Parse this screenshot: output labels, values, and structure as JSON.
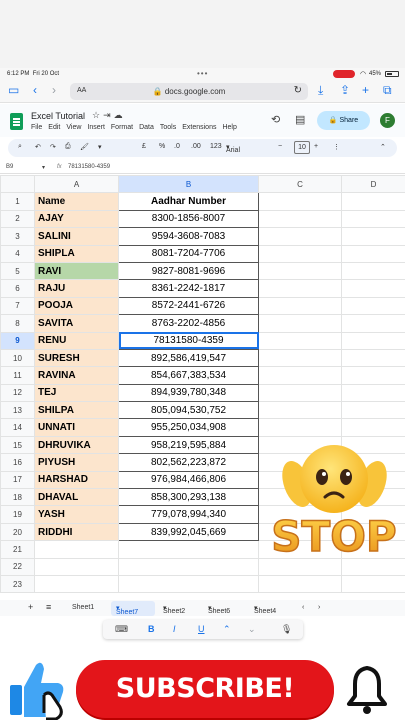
{
  "status": {
    "time": "6:12 PM",
    "date": "Fri 20 Oct",
    "battery": "45%"
  },
  "browser": {
    "aa": "AA",
    "url": "docs.google.com"
  },
  "sheets": {
    "title": "Excel Tutorial",
    "menu": [
      "File",
      "Edit",
      "View",
      "Insert",
      "Format",
      "Data",
      "Tools",
      "Extensions",
      "Help"
    ],
    "share_label": "Share",
    "avatar_letter": "F"
  },
  "toolbar": {
    "percent": "%",
    "dec_less": ".0",
    "dec_more": ".00",
    "num_fmt": "123",
    "font": "Arial",
    "font_size": "10"
  },
  "formula": {
    "cell_ref": "B9",
    "fx": "fx",
    "value": "78131580-4359"
  },
  "grid": {
    "columns": [
      "A",
      "B",
      "C",
      "D"
    ],
    "headers": {
      "name": "Name",
      "aadhar": "Aadhar Number"
    },
    "rows": [
      {
        "num": "1"
      },
      {
        "num": "2",
        "name": "AJAY",
        "aadhar": "8300-1856-8007"
      },
      {
        "num": "3",
        "name": "SALINI",
        "aadhar": "9594-3608-7083"
      },
      {
        "num": "4",
        "name": "SHIPLA",
        "aadhar": "8081-7204-7706"
      },
      {
        "num": "5",
        "name": "RAVI",
        "aadhar": "9827-8081-9696"
      },
      {
        "num": "6",
        "name": "RAJU",
        "aadhar": "8361-2242-1817"
      },
      {
        "num": "7",
        "name": "POOJA",
        "aadhar": "8572-2441-6726"
      },
      {
        "num": "8",
        "name": "SAVITA",
        "aadhar": "8763-2202-4856"
      },
      {
        "num": "9",
        "name": "RENU",
        "aadhar": "78131580-4359"
      },
      {
        "num": "10",
        "name": "SURESH",
        "aadhar": "892,586,419,547"
      },
      {
        "num": "11",
        "name": "RAVINA",
        "aadhar": "854,667,383,534"
      },
      {
        "num": "12",
        "name": "TEJ",
        "aadhar": "894,939,780,348"
      },
      {
        "num": "13",
        "name": "SHILPA",
        "aadhar": "805,094,530,752"
      },
      {
        "num": "14",
        "name": "UNNATI",
        "aadhar": "955,250,034,908"
      },
      {
        "num": "15",
        "name": "DHRUVIKA",
        "aadhar": "958,219,595,884"
      },
      {
        "num": "16",
        "name": "PIYUSH",
        "aadhar": "802,562,223,872"
      },
      {
        "num": "17",
        "name": "HARSHAD",
        "aadhar": "976,984,466,806"
      },
      {
        "num": "18",
        "name": "DHAVAL",
        "aadhar": "858,300,293,138"
      },
      {
        "num": "19",
        "name": "YASH",
        "aadhar": "779,078,994,340"
      },
      {
        "num": "20",
        "name": "RIDDHI",
        "aadhar": "839,992,045,669"
      },
      {
        "num": "21"
      },
      {
        "num": "22"
      },
      {
        "num": "23"
      }
    ]
  },
  "tabs": [
    "Sheet1",
    "Sheet7",
    "Sheet2",
    "Sheet6",
    "Sheet4"
  ],
  "keyboard_bar": {
    "bold": "B",
    "italic": "I",
    "underline": "U"
  },
  "overlay": {
    "subscribe": "SUBSCRIBE!",
    "sticker_text": "STOP"
  },
  "colors": {
    "name_fill": "#fce5cd",
    "highlight_fill": "#b6d7a8",
    "subscribe_red": "#e3151a",
    "selection_blue": "#1a73e8"
  }
}
